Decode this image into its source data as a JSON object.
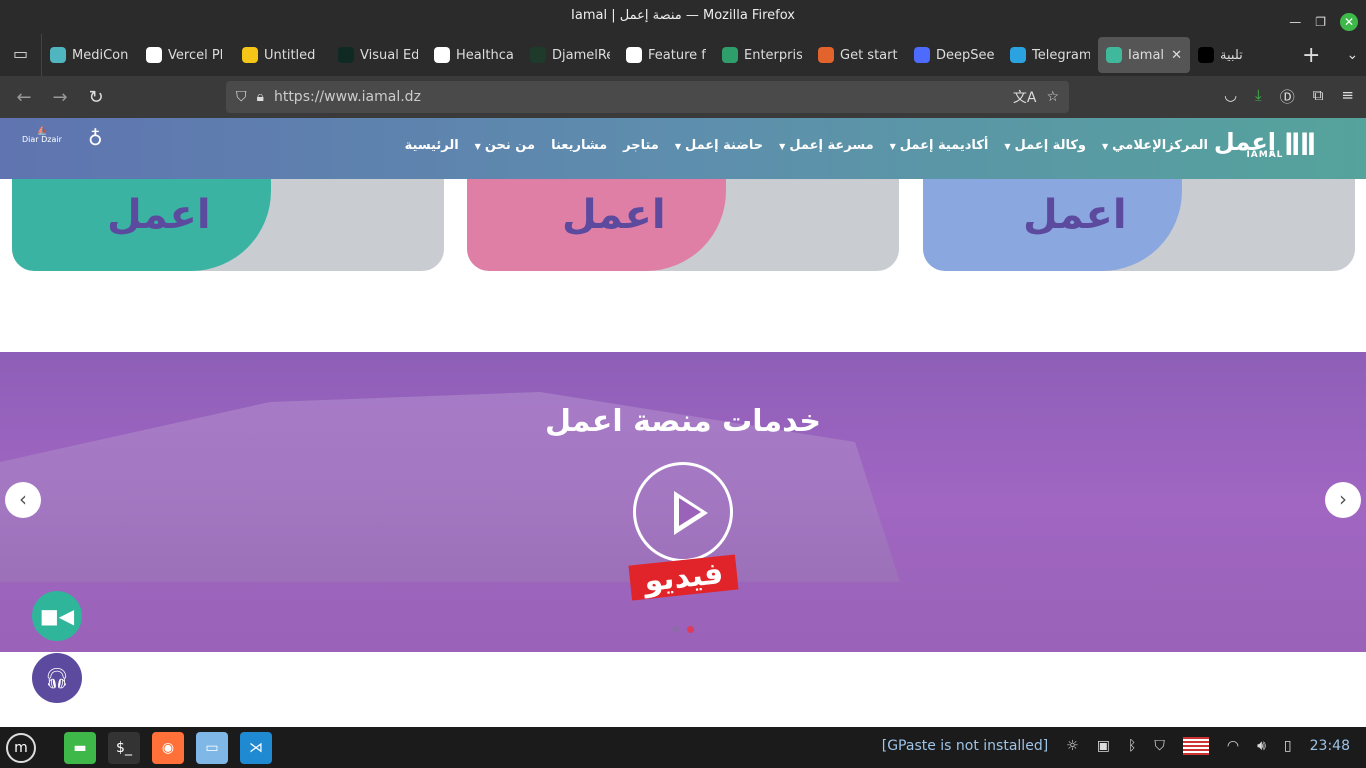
{
  "window": {
    "title": "Iamal | منصة إعمل — Mozilla Firefox"
  },
  "tabs": [
    {
      "label": "MediCon",
      "color": "#4fb6c0"
    },
    {
      "label": "Vercel Pl",
      "color": "#ffffff"
    },
    {
      "label": "Untitled",
      "color": "#f5c518"
    },
    {
      "label": "Visual Ed",
      "color": "#0f2a22"
    },
    {
      "label": "Healthca",
      "color": "#ffffff"
    },
    {
      "label": "DjamelRe",
      "color": "#1d3a2a"
    },
    {
      "label": "Feature f",
      "color": "#ffffff"
    },
    {
      "label": "Enterpris",
      "color": "#2e9e6b"
    },
    {
      "label": "Get start",
      "color": "#e2642c"
    },
    {
      "label": "DeepSee",
      "color": "#4d6bfe"
    },
    {
      "label": "Telegram",
      "color": "#2aa3e0"
    },
    {
      "label": "Iamal | ",
      "color": "#3fb89c",
      "active": true
    },
    {
      "label": "تلبية",
      "color": "#000000"
    }
  ],
  "address": {
    "url": "https://www.iamal.dz"
  },
  "site": {
    "logo": "إعمل",
    "logo_sub": "IAMAL",
    "partner1": "Diar Dzair",
    "partner2": "",
    "menu": [
      "الرئيسية",
      "من نحن",
      "مشاريعنا",
      "متاجر",
      "حاضنة إعمل",
      "مسرعة إعمل",
      "أكاديمية إعمل",
      "وكالة إعمل",
      "المركزالإعلامي"
    ],
    "menu_dropdown": [
      false,
      true,
      false,
      false,
      true,
      true,
      true,
      true,
      true
    ],
    "cards": [
      {
        "text": "اعمل",
        "color": "#3bb3a3"
      },
      {
        "text": "اعمل",
        "color": "#e07fa6"
      },
      {
        "text": "اعمل",
        "color": "#8aa7e0"
      }
    ],
    "hero": {
      "title": "خدمات منصة اعمل",
      "badge": "فيديو",
      "slide": 2,
      "slides": 2
    }
  },
  "taskbar": {
    "gpaste": "[GPaste is not installed]",
    "clock": "23:48"
  }
}
